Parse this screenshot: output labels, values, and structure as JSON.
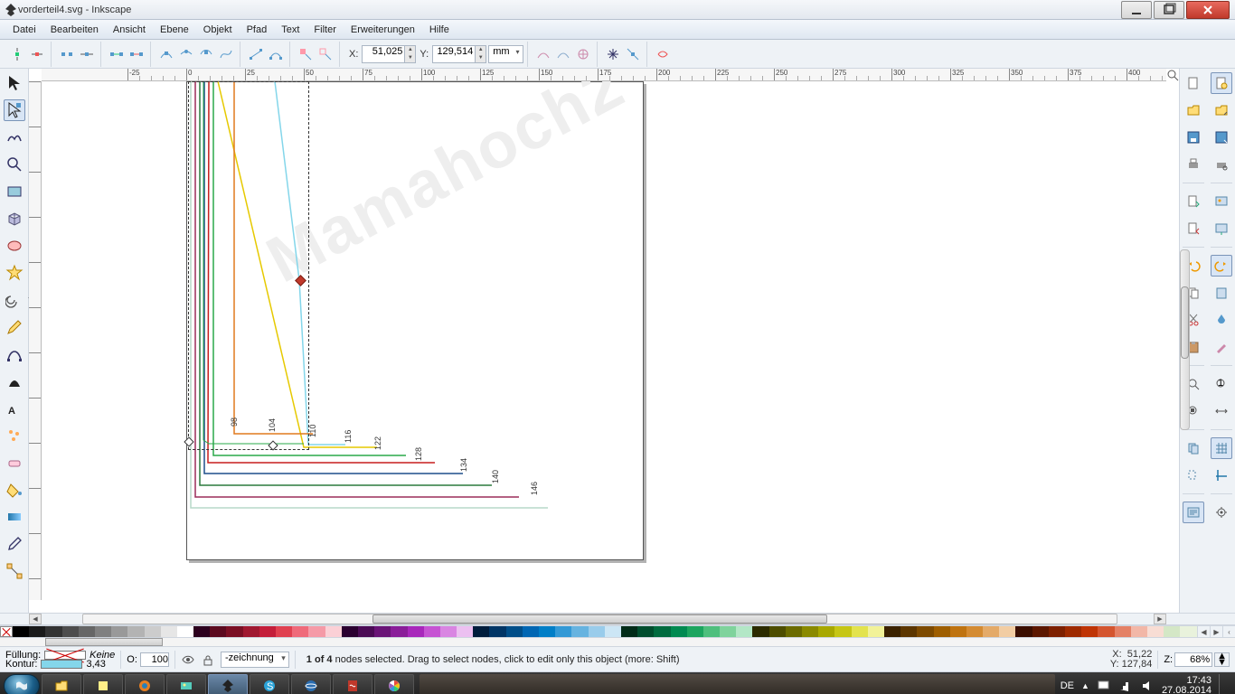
{
  "window": {
    "title": "vorderteil4.svg - Inkscape"
  },
  "menu": [
    "Datei",
    "Bearbeiten",
    "Ansicht",
    "Ebene",
    "Objekt",
    "Pfad",
    "Text",
    "Filter",
    "Erweiterungen",
    "Hilfe"
  ],
  "toolbar_coords": {
    "x_label": "X:",
    "x_val": "51,025",
    "y_label": "Y:",
    "y_val": "129,514",
    "unit": "mm"
  },
  "ruler_h": {
    "start": -25,
    "end": 460,
    "step": 25
  },
  "sizes": [
    "98",
    "104",
    "110",
    "116",
    "122",
    "128",
    "134",
    "140",
    "146"
  ],
  "watermark": "Mamahoch2",
  "status": {
    "fill_label": "Füllung:",
    "fill_value": "Keine",
    "stroke_label": "Kontur:",
    "stroke_value": "3,43",
    "opacity_label": "O:",
    "opacity_value": "100",
    "layer_prefix": "-",
    "layer_name": "zeichnung",
    "message": "1 of 4 nodes selected. Drag to select nodes, click to edit only this object (more: Shift)",
    "coord_x_lbl": "X:",
    "coord_x": "51,22",
    "coord_y_lbl": "Y:",
    "coord_y": "127,84",
    "zoom_lbl": "Z:",
    "zoom_val": "68%"
  },
  "taskbar": {
    "lang": "DE",
    "time": "17:43",
    "date": "27.08.2014"
  },
  "palette_colors": [
    "#000000",
    "#1a1a1a",
    "#333333",
    "#4d4d4d",
    "#666666",
    "#808080",
    "#999999",
    "#b3b3b3",
    "#cccccc",
    "#e6e6e6",
    "#ffffff",
    "#2c001e",
    "#5c0a1f",
    "#7b0f24",
    "#a01830",
    "#c41e3a",
    "#e04050",
    "#ef6a7a",
    "#f59aa7",
    "#fbd0d6",
    "#2b0030",
    "#4b0b55",
    "#6a1477",
    "#8a1d99",
    "#a827bb",
    "#c653d3",
    "#d985e2",
    "#ecc0f1",
    "#001d3d",
    "#003566",
    "#004e89",
    "#0066b3",
    "#007ec7",
    "#3399d6",
    "#66b3e0",
    "#99cceb",
    "#cce6f5",
    "#002b18",
    "#004d2e",
    "#006b3f",
    "#008a51",
    "#1ca55f",
    "#4ebf7d",
    "#7fd39c",
    "#b3e7c6",
    "#2b2b00",
    "#4d4d00",
    "#6b6b00",
    "#8a8a00",
    "#a8a800",
    "#c6c615",
    "#e3e34d",
    "#f2f299",
    "#3b2200",
    "#5c3600",
    "#7d4a00",
    "#9e5e00",
    "#bf7310",
    "#d48b32",
    "#e4aa68",
    "#f2cda3",
    "#3b0e00",
    "#5c1700",
    "#7d2000",
    "#9e2a00",
    "#bf3405",
    "#d4552f",
    "#e48166",
    "#f2b7a7",
    "#f8ddd4",
    "#d4e7c6",
    "#e9f2dc"
  ]
}
